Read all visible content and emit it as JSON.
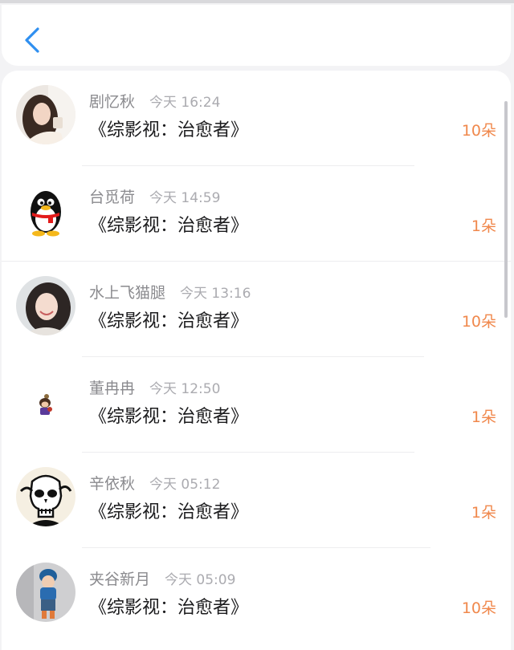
{
  "header": {
    "back_icon": "chevron-left-icon",
    "accent_color": "#2f8ff0"
  },
  "colors": {
    "name": "#8a8a8e",
    "time": "#ababb0",
    "title": "#1b1b1d",
    "flowers": "#f0884c"
  },
  "rows": [
    {
      "name": "剧忆秋",
      "time": "今天 16:24",
      "title": "《综影视：治愈者》",
      "flowers": "10朵",
      "avatar_icon": "avatar-photo-woman-icon"
    },
    {
      "name": "台觅荷",
      "time": "今天 14:59",
      "title": "《综影视：治愈者》",
      "flowers": "1朵",
      "avatar_icon": "qq-penguin-icon"
    },
    {
      "name": "水上飞猫腿",
      "time": "今天 13:16",
      "title": "《综影视：治愈者》",
      "flowers": "10朵",
      "avatar_icon": "avatar-photo-girl-icon"
    },
    {
      "name": "董冉冉",
      "time": "今天 12:50",
      "title": "《综影视：治愈者》",
      "flowers": "1朵",
      "avatar_icon": "avatar-cartoon-icon"
    },
    {
      "name": "辛依秋",
      "time": "今天 05:12",
      "title": "《综影视：治愈者》",
      "flowers": "1朵",
      "avatar_icon": "avatar-skull-art-icon"
    },
    {
      "name": "夹谷新月",
      "time": "今天 05:09",
      "title": "《综影视：治愈者》",
      "flowers": "10朵",
      "avatar_icon": "avatar-child-photo-icon"
    }
  ]
}
